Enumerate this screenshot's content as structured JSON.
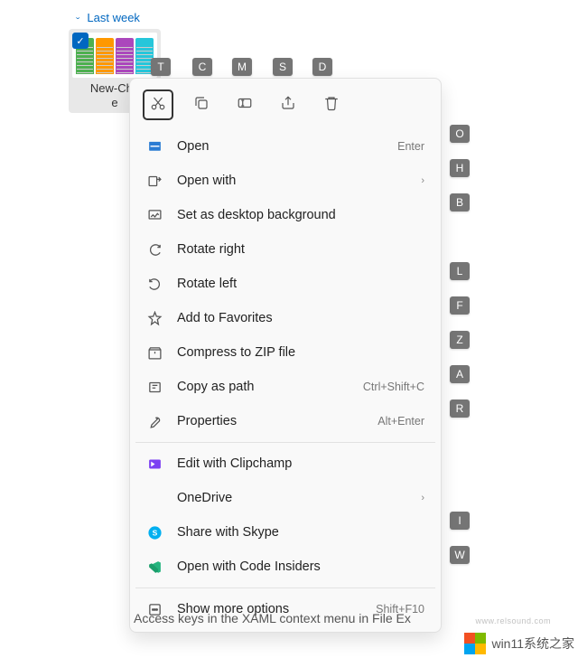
{
  "group": {
    "label": "Last week"
  },
  "file": {
    "name_line1": "New-Cha",
    "name_line2": "e"
  },
  "toolbar_keys": [
    "T",
    "C",
    "M",
    "S",
    "D"
  ],
  "menu_keys": {
    "open": "O",
    "open_with": "H",
    "desktop_bg": "B",
    "rotate_left": "L",
    "favorites": "F",
    "compress": "Z",
    "copy_path": "A",
    "properties": "R",
    "share_skype": "I",
    "code_insiders": "W"
  },
  "menu": {
    "open": {
      "label": "Open",
      "shortcut": "Enter"
    },
    "open_with": {
      "label": "Open with"
    },
    "desktop_bg": {
      "label": "Set as desktop background"
    },
    "rotate_right": {
      "label": "Rotate right"
    },
    "rotate_left": {
      "label": "Rotate left"
    },
    "favorites": {
      "label": "Add to Favorites"
    },
    "compress": {
      "label": "Compress to ZIP file"
    },
    "copy_path": {
      "label": "Copy as path",
      "shortcut": "Ctrl+Shift+C"
    },
    "properties": {
      "label": "Properties",
      "shortcut": "Alt+Enter"
    },
    "clipchamp": {
      "label": "Edit with Clipchamp"
    },
    "onedrive": {
      "label": "OneDrive"
    },
    "share_skype": {
      "label": "Share with Skype"
    },
    "code_insiders": {
      "label": "Open with Code Insiders"
    },
    "more_options": {
      "label": "Show more options",
      "shortcut": "Shift+F10"
    }
  },
  "caption": "Access keys in the XAML context menu in File Ex",
  "watermark": {
    "url": "www.relsound.com",
    "text": "win11系统之家"
  }
}
